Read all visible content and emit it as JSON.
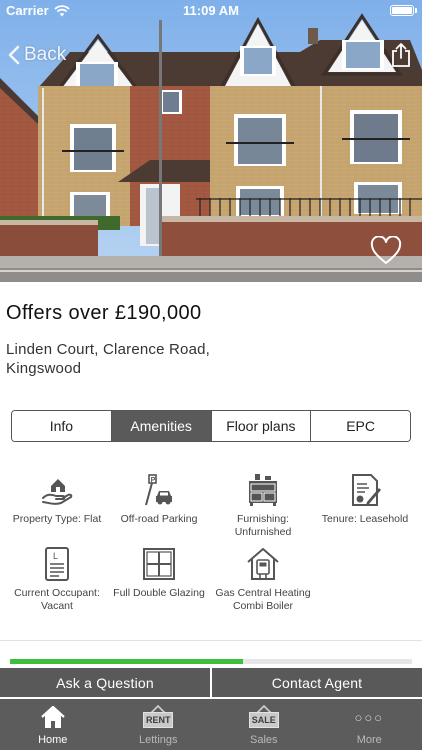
{
  "status_bar": {
    "carrier": "Carrier",
    "time": "11:09 AM"
  },
  "nav": {
    "back_label": "Back"
  },
  "listing": {
    "price": "Offers over £190,000",
    "address": "Linden Court, Clarence Road, Kingswood"
  },
  "tabs": [
    {
      "label": "Info",
      "active": false
    },
    {
      "label": "Amenities",
      "active": true
    },
    {
      "label": "Floor plans",
      "active": false
    },
    {
      "label": "EPC",
      "active": false
    }
  ],
  "amenities": [
    {
      "label": "Property Type: Flat",
      "icon": "house-in-hand-icon"
    },
    {
      "label": "Off-road Parking",
      "icon": "parking-car-icon"
    },
    {
      "label": "Furnishing: Unfurnished",
      "icon": "furniture-icon"
    },
    {
      "label": "Tenure: Leasehold",
      "icon": "certificate-icon"
    },
    {
      "label": "Current Occupant: Vacant",
      "icon": "document-icon"
    },
    {
      "label": "Full Double Glazing",
      "icon": "window-icon"
    },
    {
      "label": "Gas Central Heating Combi Boiler",
      "icon": "boiler-icon"
    }
  ],
  "progress": {
    "value": 0.58
  },
  "actions": {
    "ask_label": "Ask a Question",
    "contact_label": "Contact Agent"
  },
  "tabbar": [
    {
      "label": "Home",
      "icon": "home-icon",
      "active": true
    },
    {
      "label": "Lettings",
      "icon": "rent-sign-icon",
      "sign_text": "RENT",
      "active": false
    },
    {
      "label": "Sales",
      "icon": "sale-sign-icon",
      "sign_text": "SALE",
      "active": false
    },
    {
      "label": "More",
      "icon": "more-dots-icon",
      "active": false
    }
  ],
  "colors": {
    "active_tab": "#5a5a5a",
    "progress": "#3cbf3c",
    "button": "#595959",
    "tabbar": "#5c5c5c"
  }
}
